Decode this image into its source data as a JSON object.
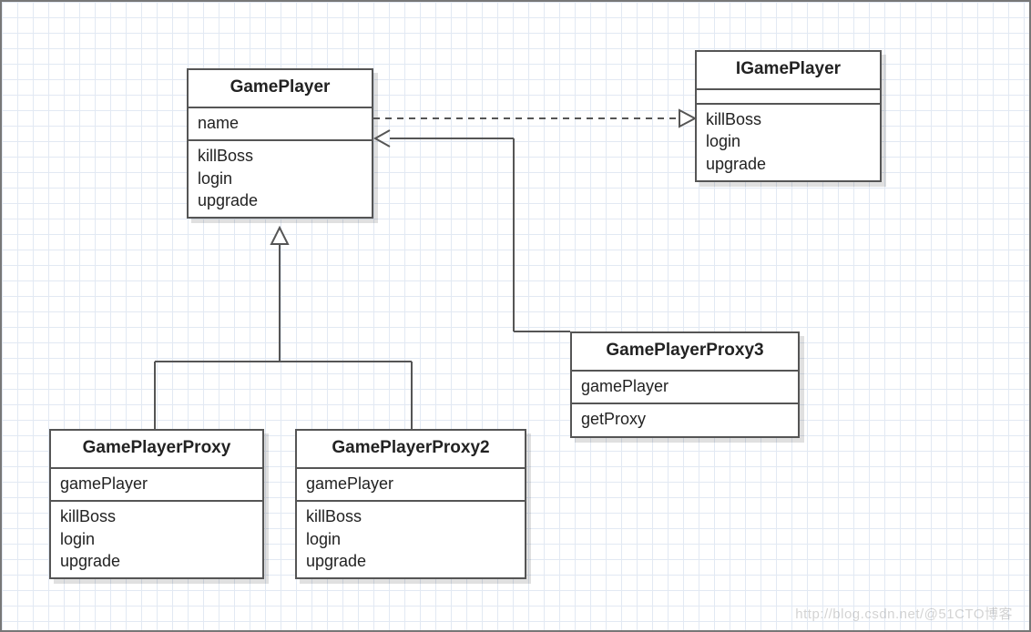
{
  "classes": {
    "gamePlayer": {
      "name": "GamePlayer",
      "attributes": [
        "name"
      ],
      "methods": [
        "killBoss",
        "login",
        "upgrade"
      ]
    },
    "iGamePlayer": {
      "name": "IGamePlayer",
      "attributes": [],
      "methods": [
        "killBoss",
        "login",
        "upgrade"
      ]
    },
    "gamePlayerProxy": {
      "name": "GamePlayerProxy",
      "attributes": [
        "gamePlayer"
      ],
      "methods": [
        "killBoss",
        "login",
        "upgrade"
      ]
    },
    "gamePlayerProxy2": {
      "name": "GamePlayerProxy2",
      "attributes": [
        "gamePlayer"
      ],
      "methods": [
        "killBoss",
        "login",
        "upgrade"
      ]
    },
    "gamePlayerProxy3": {
      "name": "GamePlayerProxy3",
      "attributes": [
        "gamePlayer"
      ],
      "methods": [
        "getProxy"
      ]
    }
  },
  "watermark": "http://blog.csdn.net/@51CTO博客"
}
